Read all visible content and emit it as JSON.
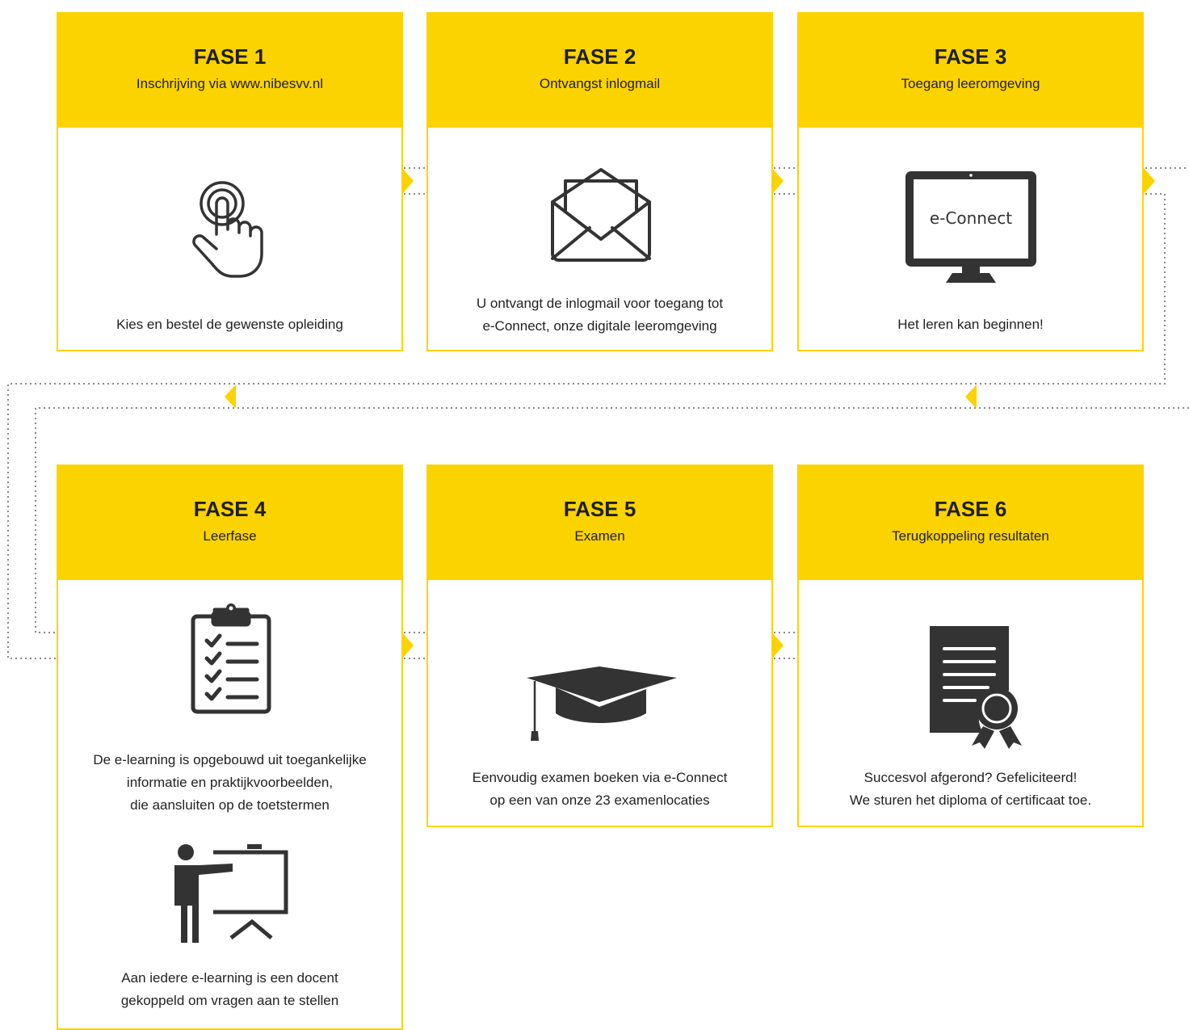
{
  "phases": [
    {
      "title": "FASE 1",
      "subtitle": "Inschrijving via www.nibesvv.nl",
      "description": [
        "Kies en bestel de gewenste opleiding"
      ],
      "icon": "touch-hand-icon"
    },
    {
      "title": "FASE 2",
      "subtitle": "Ontvangst inlogmail",
      "description": [
        "U ontvangt de inlogmail voor toegang tot",
        "e-Connect, onze digitale leeromgeving"
      ],
      "icon": "envelope-open-icon"
    },
    {
      "title": "FASE 3",
      "subtitle": "Toegang leeromgeving",
      "description": [
        "Het leren kan beginnen!"
      ],
      "icon": "monitor-icon",
      "screen_text": "e-Connect"
    },
    {
      "title": "FASE 4",
      "subtitle": "Leerfase",
      "description": [
        "De e-learning is opgebouwd uit toegankelijke",
        "informatie en praktijkvoorbeelden,",
        "die aansluiten op de toetstermen"
      ],
      "description2": [
        "Aan iedere e-learning is een docent",
        "gekoppeld om vragen aan te stellen"
      ],
      "icon": "clipboard-checklist-icon",
      "icon2": "teacher-presentation-icon"
    },
    {
      "title": "FASE 5",
      "subtitle": "Examen",
      "description": [
        "Eenvoudig examen boeken via e-Connect",
        "op een van onze 23 examenlocaties"
      ],
      "icon": "graduation-cap-icon"
    },
    {
      "title": "FASE 6",
      "subtitle": "Terugkoppeling resultaten",
      "description": [
        "Succesvol afgerond? Gefeliciteerd!",
        "We sturen het diploma of certificaat toe."
      ],
      "icon": "certificate-icon"
    }
  ],
  "colors": {
    "accent": "#fbd300",
    "icon": "#333333",
    "dots": "#888888"
  }
}
